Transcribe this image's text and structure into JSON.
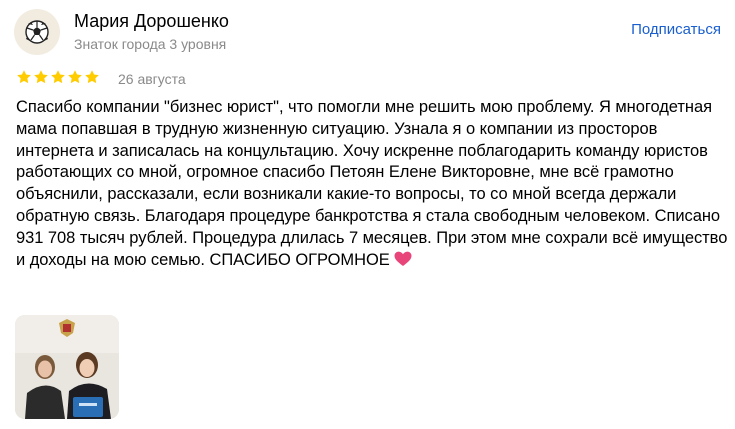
{
  "review": {
    "author": {
      "name": "Мария Дорошенко",
      "level": "Знаток города 3 уровня",
      "avatar_icon": "soccer-ball-icon"
    },
    "subscribe_label": "Подписаться",
    "rating": {
      "value": 5,
      "max": 5,
      "color": "#ffcc00"
    },
    "date": "26 августа",
    "text": "Спасибо компании \"бизнес юрист\", что помогли мне решить мою проблему. Я многодетная мама попавшая в трудную жизненную ситуацию. Узнала я о компании из просторов интернета и записалась на концультацию. Хочу искренне поблагодарить команду юристов работающих со мной, огромное спасибо Петоян Елене Викторовне, мне всё грамотно объяснили, рассказали, если возникали какие-то вопросы, то со мной всегда держали обратную связь. Благодаря процедуре банкротства я стала свободным человеком. Списано 931 708 тысяч рублей. Процедура длилась 7 месяцев. При этом мне сохрали всё имущество и доходы на мою семью. СПАСИБО ОГРОМНОЕ",
    "text_end_icon": "pink-heart-icon",
    "photos": [
      {
        "icon": "review-photo-thumbnail"
      }
    ]
  },
  "colors": {
    "link": "#1a5fcf",
    "secondary_text": "#8a8a8a",
    "star": "#ffcc00",
    "heart": "#e8457a"
  }
}
